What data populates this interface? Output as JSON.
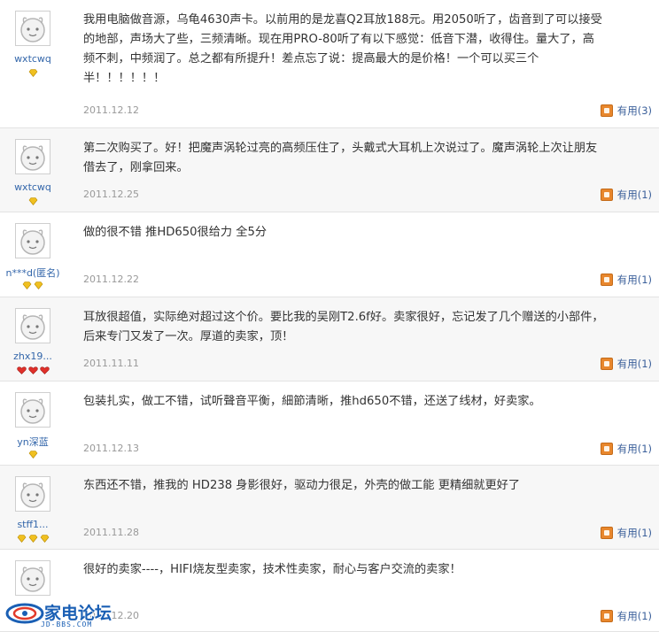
{
  "reviews": [
    {
      "username": "wxtcwq",
      "badge_count": 1,
      "badge_type": "diamond",
      "text": "我用电脑做音源，乌龟4630声卡。以前用的是龙喜Q2耳放188元。用2050听了，齿音到了可以接受的地部，声场大了些，三频清晰。现在用PRO-80听了有以下感觉：低音下潜，收得住。量大了，高频不刺，中频润了。总之都有所提升！差点忘了说：提高最大的是价格！一个可以买三个半！！！！！！",
      "date": "2011.12.12",
      "useful": "有用(3)"
    },
    {
      "username": "wxtcwq",
      "badge_count": 1,
      "badge_type": "diamond",
      "text": "第二次购买了。好！把魔声涡轮过亮的高频压住了，头戴式大耳机上次说过了。魔声涡轮上次让朋友借去了，刚拿回来。",
      "date": "2011.12.25",
      "useful": "有用(1)"
    },
    {
      "username": "n***d(匿名)",
      "badge_count": 2,
      "badge_type": "diamond",
      "text": "做的很不错 推HD650很给力 全5分",
      "date": "2011.12.22",
      "useful": "有用(1)"
    },
    {
      "username": "zhx19...",
      "badge_count": 3,
      "badge_type": "heart",
      "text": "耳放很超值，实际绝对超过这个价。要比我的吴刚T2.6f好。卖家很好，忘记发了几个赠送的小部件，后来专门又发了一次。厚道的卖家，顶！",
      "date": "2011.11.11",
      "useful": "有用(1)"
    },
    {
      "username": "yn深蓝",
      "badge_count": 1,
      "badge_type": "diamond",
      "text": "包装扎实，做工不错，试听聲音平衡，細節清晰，推hd650不错，还送了线材，好卖家。",
      "date": "2011.12.13",
      "useful": "有用(1)"
    },
    {
      "username": "stff1...",
      "badge_count": 3,
      "badge_type": "diamond",
      "text": "东西还不错，推我的 HD238 身影很好，驱动力很足，外壳的做工能 更精细就更好了",
      "date": "2011.11.28",
      "useful": "有用(1)"
    },
    {
      "username": "",
      "badge_count": 0,
      "badge_type": "diamond",
      "text": "很好的卖家----，HIFI烧友型卖家，技术性卖家，耐心与客户交流的卖家！",
      "date": "2011.12.20",
      "useful": "有用(1)"
    }
  ],
  "watermark": {
    "title": "家电论坛",
    "url": "JD-BBS.COM"
  },
  "colors": {
    "diamond": "#f0c020",
    "heart": "#e0302a",
    "link": "#3366aa",
    "useful_icon": "#e8872d"
  }
}
